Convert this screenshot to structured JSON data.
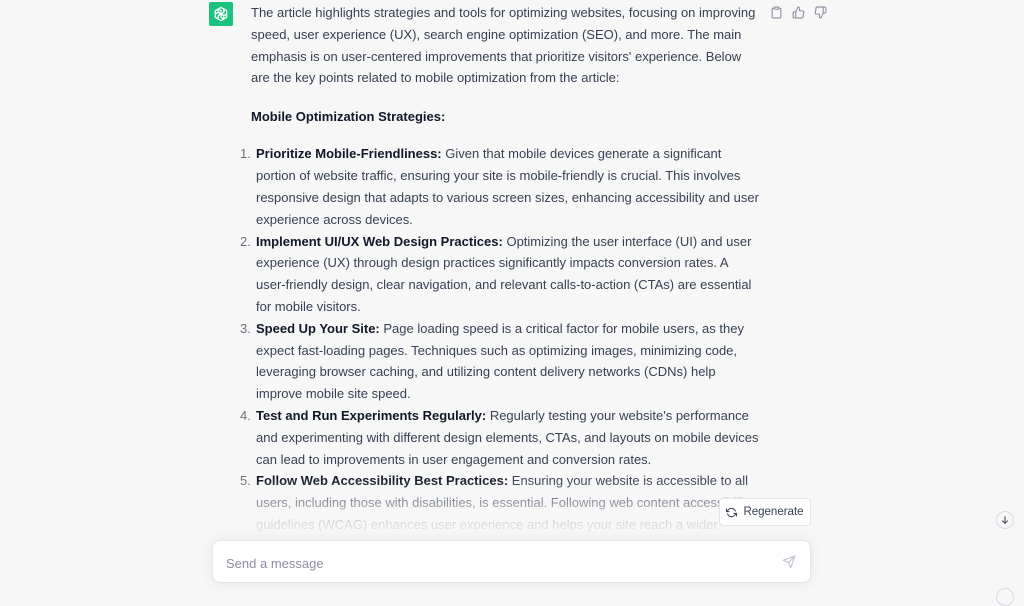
{
  "message": {
    "intro": "The article highlights strategies and tools for optimizing websites, focusing on improving speed, user experience (UX), search engine optimization (SEO), and more. The main emphasis is on user-centered improvements that prioritize visitors' experience. Below are the key points related to mobile optimization from the article:",
    "heading": "Mobile Optimization Strategies:",
    "items": [
      {
        "num": "1.",
        "title": "Prioritize Mobile-Friendliness:",
        "text": " Given that mobile devices generate a significant portion of website traffic, ensuring your site is mobile-friendly is crucial. This involves responsive design that adapts to various screen sizes, enhancing accessibility and user experience across devices."
      },
      {
        "num": "2.",
        "title": "Implement UI/UX Web Design Practices:",
        "text": " Optimizing the user interface (UI) and user experience (UX) through design practices significantly impacts conversion rates. A user-friendly design, clear navigation, and relevant calls-to-action (CTAs) are essential for mobile visitors."
      },
      {
        "num": "3.",
        "title": "Speed Up Your Site:",
        "text": " Page loading speed is a critical factor for mobile users, as they expect fast-loading pages. Techniques such as optimizing images, minimizing code, leveraging browser caching, and utilizing content delivery networks (CDNs) help improve mobile site speed."
      },
      {
        "num": "4.",
        "title": "Test and Run Experiments Regularly:",
        "text": " Regularly testing your website's performance and experimenting with different design elements, CTAs, and layouts on mobile devices can lead to improvements in user engagement and conversion rates."
      },
      {
        "num": "5.",
        "title": "Follow Web Accessibility Best Practices:",
        "text": " Ensuring your website is accessible to all users, including those with disabilities, is essential. Following web content accessibility guidelines (WCAG) enhances user experience and helps your site reach a wider audience."
      }
    ]
  },
  "actions": {
    "copy_icon": "clipboard-icon",
    "like_icon": "thumbs-up-icon",
    "dislike_icon": "thumbs-down-icon"
  },
  "regenerate": {
    "label": "Regenerate",
    "icon": "refresh-icon"
  },
  "composer": {
    "placeholder": "Send a message",
    "send_icon": "send-icon"
  },
  "scroll_icon": "arrow-down-icon",
  "colors": {
    "brand": "#19c37d",
    "background": "#f7f7f8",
    "text": "#374151"
  }
}
